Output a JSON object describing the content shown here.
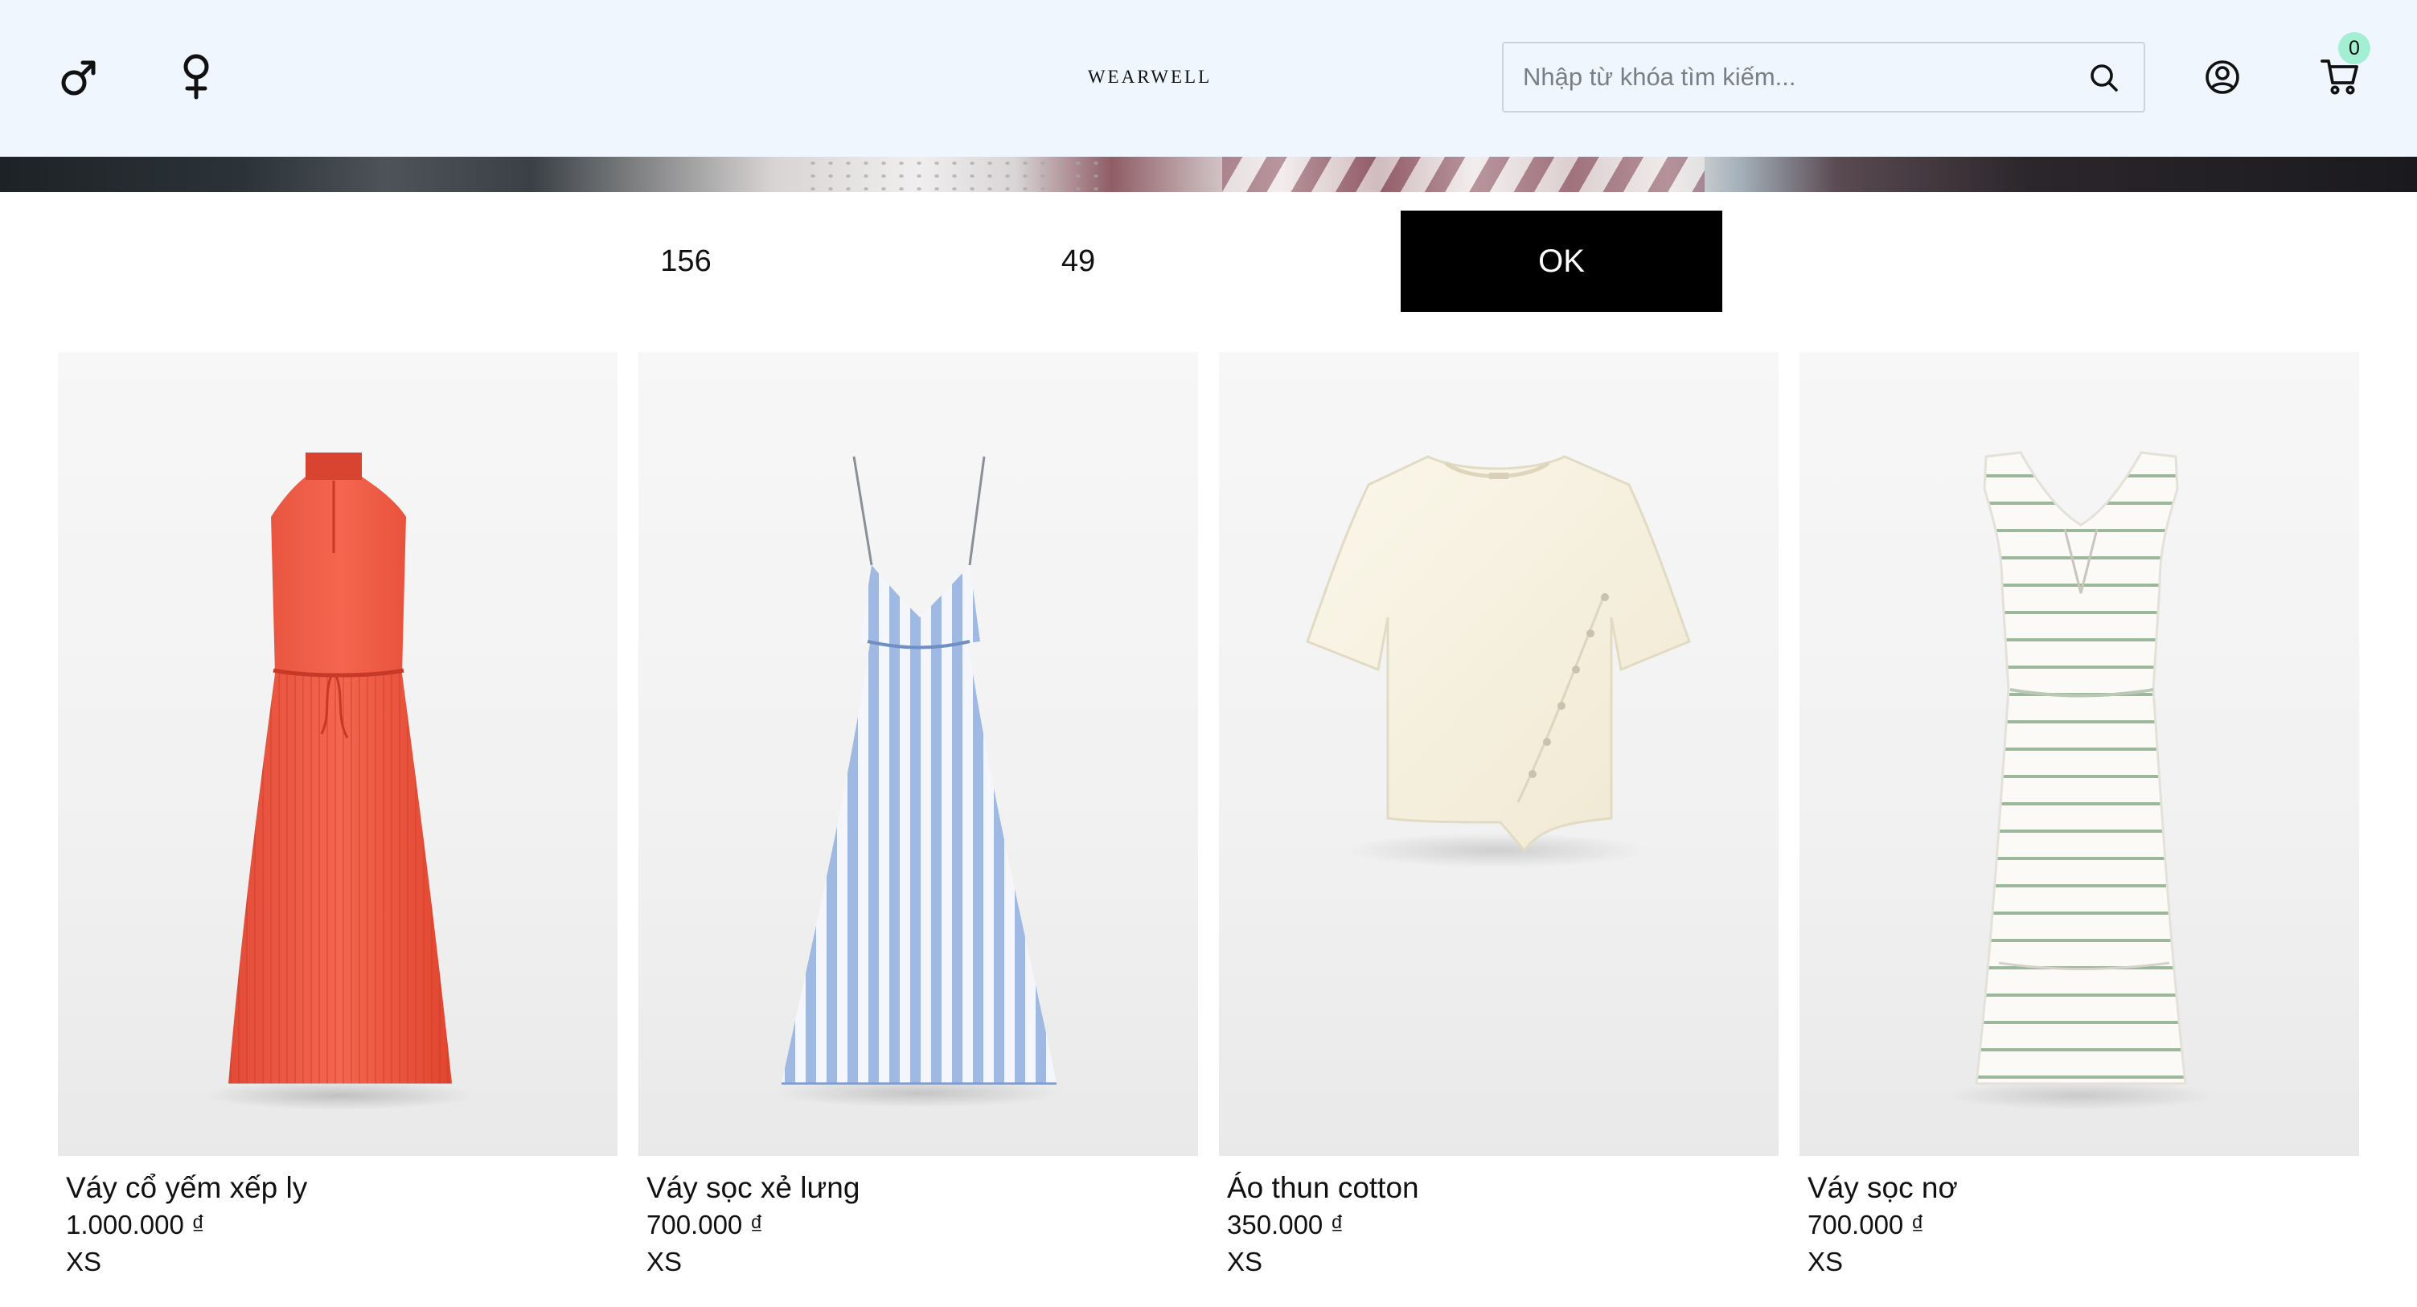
{
  "header": {
    "brand": "WEARWELL",
    "search_placeholder": "Nhập từ khóa tìm kiếm...",
    "cart_count": "0",
    "icons": [
      "male-icon",
      "female-icon",
      "search-icon",
      "account-icon",
      "cart-icon"
    ]
  },
  "filter": {
    "price_min": "156",
    "price_max": "49",
    "ok_label": "OK"
  },
  "products": [
    {
      "name": "Váy cổ yếm xếp ly",
      "price": "1.000.000 ₫",
      "size": "XS",
      "color": "#ef5a45"
    },
    {
      "name": "Váy sọc xẻ lưng",
      "price": "700.000 ₫",
      "size": "XS",
      "color": "#a9c1e6"
    },
    {
      "name": "Áo thun cotton",
      "price": "350.000 ₫",
      "size": "XS",
      "color": "#f8f3e2"
    },
    {
      "name": "Váy sọc nơ",
      "price": "700.000 ₫",
      "size": "XS",
      "color": "#fbfaf6"
    }
  ]
}
